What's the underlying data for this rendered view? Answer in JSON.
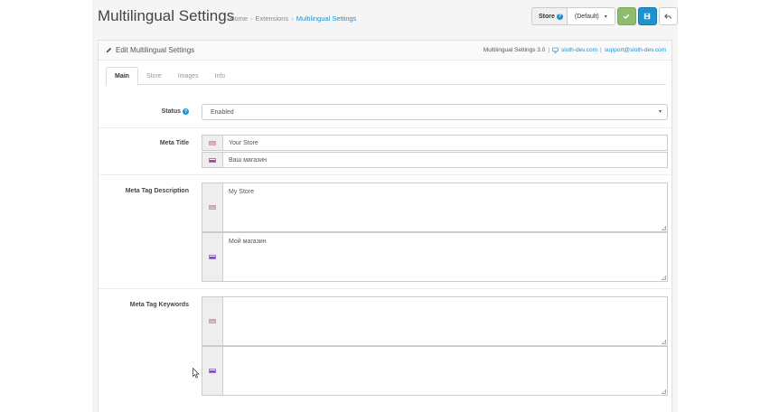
{
  "header": {
    "title": "Multilingual Settings",
    "breadcrumb": [
      "Home",
      "Extensions",
      "Multilingual Settings"
    ],
    "breadcrumb_sep": "›"
  },
  "toolbar": {
    "store_label": "Store",
    "store_help": "?",
    "store_value": "(Default)",
    "save_icon": "check-icon",
    "save_apply_icon": "floppy-icon",
    "back_icon": "reply-icon"
  },
  "panel": {
    "title": "Edit Multilingual Settings",
    "title_icon": "pencil-icon",
    "version": "Multilingual Settings 3.0",
    "sep": "|",
    "site_link": "sloth-dev.com",
    "support_link": "support@sloth-dev.com"
  },
  "tabs": [
    {
      "label": "Main",
      "active": true
    },
    {
      "label": "Store",
      "active": false
    },
    {
      "label": "Images",
      "active": false
    },
    {
      "label": "Info",
      "active": false
    }
  ],
  "form": {
    "status": {
      "label": "Status",
      "help": "?",
      "value": "Enabled"
    },
    "meta_title": {
      "label": "Meta Title",
      "en": "Your Store",
      "ru": "Ваш магазин"
    },
    "meta_description": {
      "label": "Meta Tag Description",
      "en": "My Store",
      "ru": "Мой магазин"
    },
    "meta_keywords": {
      "label": "Meta Tag Keywords",
      "en": "",
      "ru": ""
    }
  },
  "colors": {
    "primary": "#1e91cf",
    "success": "#8fbb6c"
  }
}
